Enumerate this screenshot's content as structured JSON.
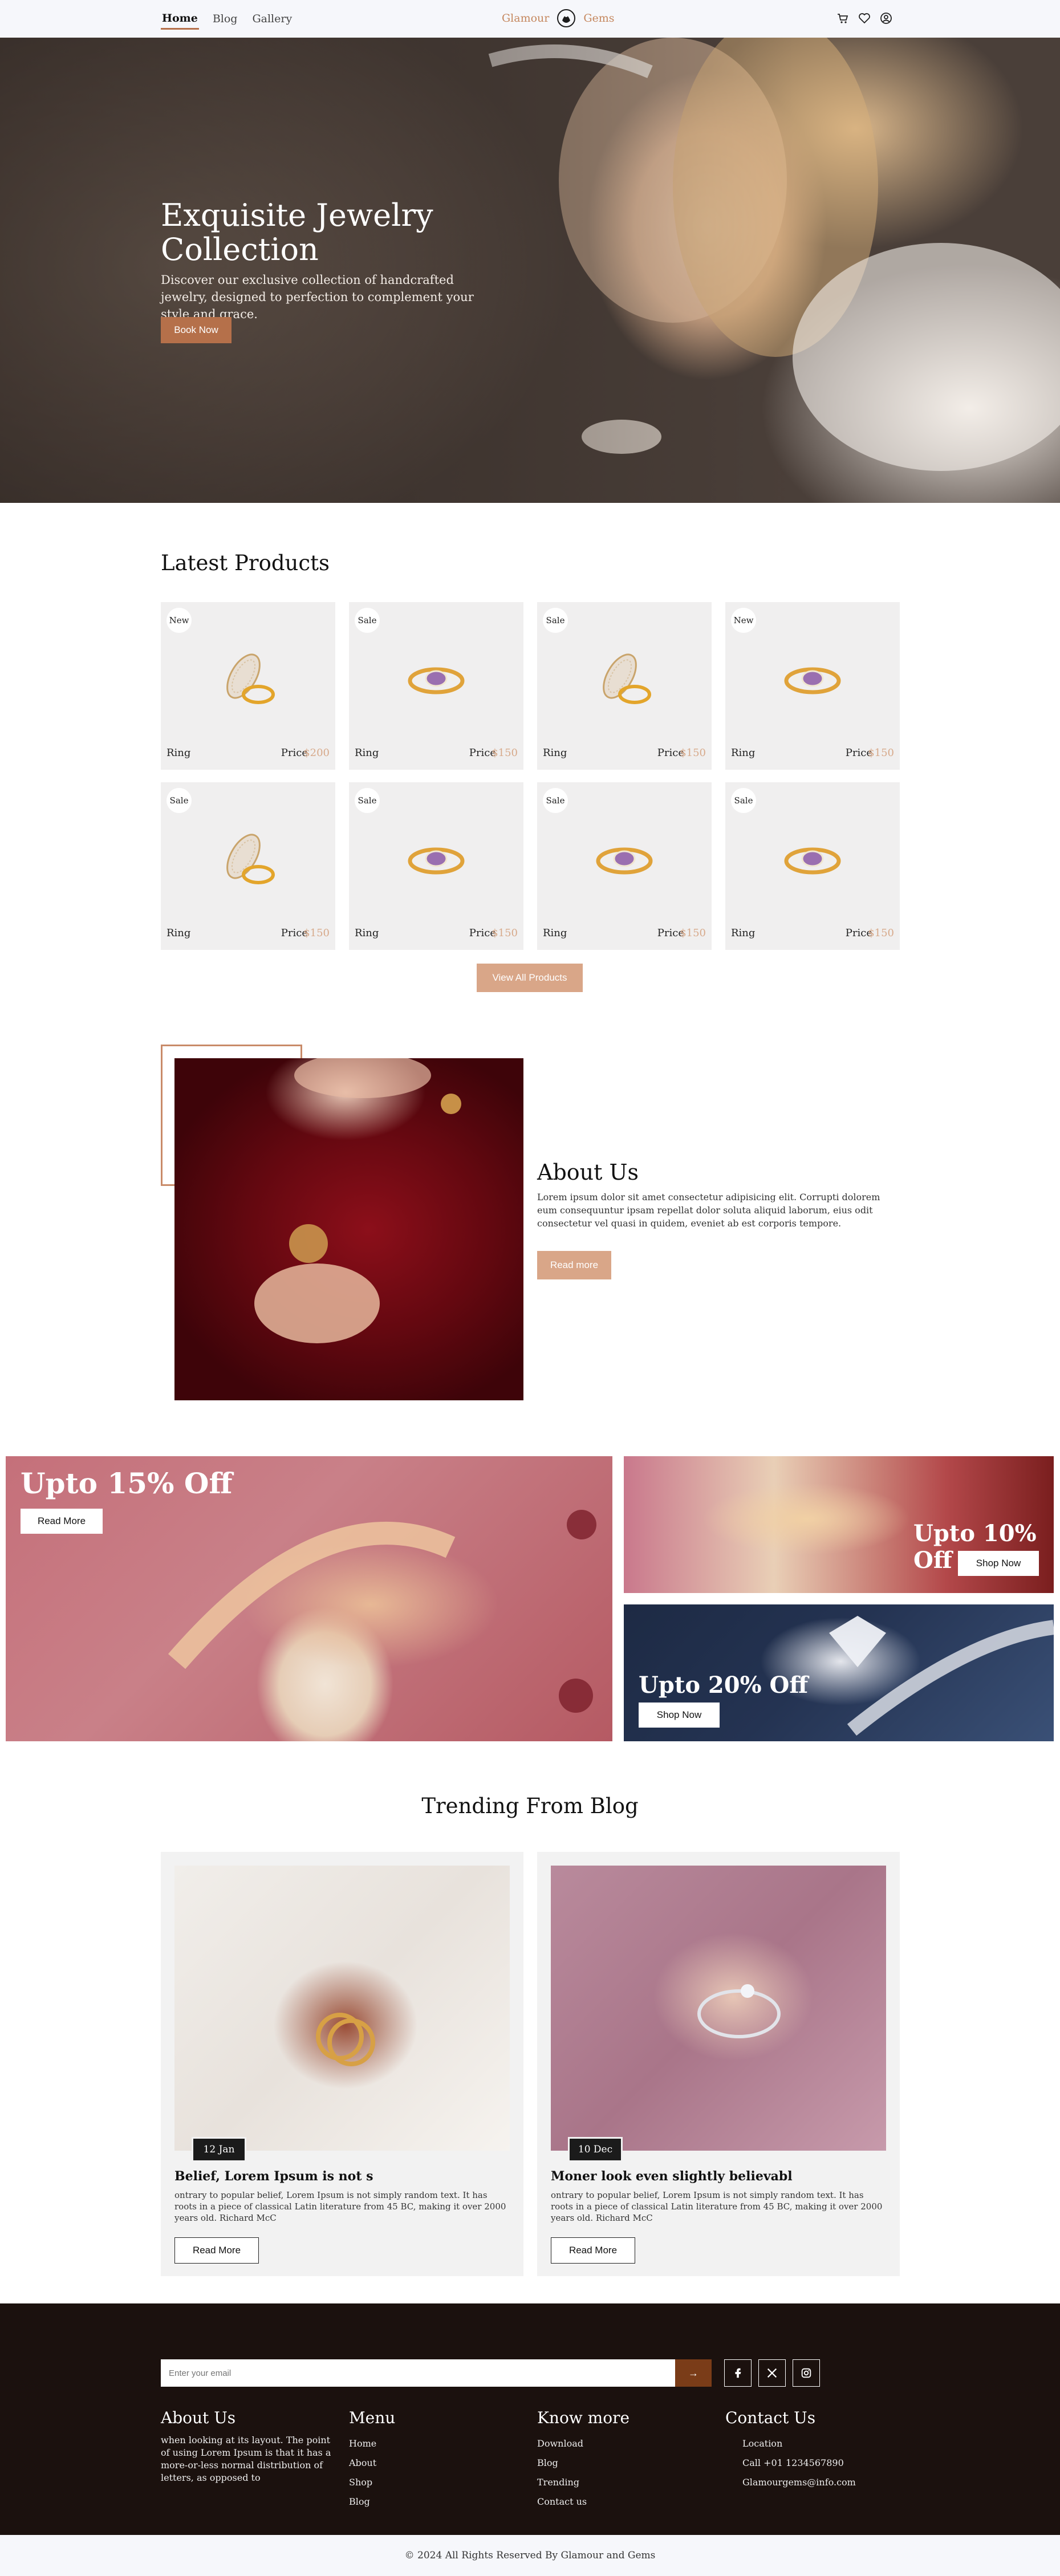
{
  "nav": {
    "links": [
      "Home",
      "Blog",
      "Gallery"
    ],
    "brand_left": "Glamour",
    "brand_right": "Gems",
    "icons": [
      "cart-icon",
      "heart-icon",
      "user-icon"
    ]
  },
  "hero": {
    "title": "Exquisite Jewelry Collection",
    "description": "Discover our exclusive collection of handcrafted jewelry, designed to perfection to complement your style and grace.",
    "button": "Book Now"
  },
  "latest": {
    "title": "Latest Products",
    "price_label": "Price",
    "products": [
      {
        "badge": "New",
        "name": "Ring",
        "price": "$200",
        "style": "diamond"
      },
      {
        "badge": "Sale",
        "name": "Ring",
        "price": "$150",
        "style": "amethyst"
      },
      {
        "badge": "Sale",
        "name": "Ring",
        "price": "$150",
        "style": "diamond"
      },
      {
        "badge": "New",
        "name": "Ring",
        "price": "$150",
        "style": "amethyst"
      },
      {
        "badge": "Sale",
        "name": "Ring",
        "price": "$150",
        "style": "diamond"
      },
      {
        "badge": "Sale",
        "name": "Ring",
        "price": "$150",
        "style": "amethyst"
      },
      {
        "badge": "Sale",
        "name": "Ring",
        "price": "$150",
        "style": "amethyst"
      },
      {
        "badge": "Sale",
        "name": "Ring",
        "price": "$150",
        "style": "amethyst"
      }
    ],
    "view_all": "View All Products"
  },
  "about": {
    "title": "About Us",
    "text": "Lorem ipsum dolor sit amet consectetur adipisicing elit. Corrupti dolorem eum consequuntur ipsam repellat dolor soluta aliquid laborum, eius odit consectetur vel quasi in quidem, eveniet ab est corporis tempore.",
    "button": "Read more"
  },
  "offers": {
    "big": {
      "title": "Upto 15% Off",
      "button": "Read More"
    },
    "top_right": {
      "title": "Upto 10% Off",
      "button": "Shop Now"
    },
    "bottom_right": {
      "title": "Upto 20% Off",
      "button": "Shop Now"
    }
  },
  "blog": {
    "title": "Trending From Blog",
    "posts": [
      {
        "date": "12 Jan",
        "title": "Belief, Lorem Ipsum is not s",
        "text": "ontrary to popular belief, Lorem Ipsum is not simply random text. It has roots in a piece of classical Latin literature from 45 BC, making it over 2000 years old. Richard McC",
        "button": "Read More"
      },
      {
        "date": "10 Dec",
        "title": "Moner look even slightly believabl",
        "text": "ontrary to popular belief, Lorem Ipsum is not simply random text. It has roots in a piece of classical Latin literature from 45 BC, making it over 2000 years old. Richard McC",
        "button": "Read More"
      }
    ]
  },
  "footer": {
    "email_placeholder": "Enter your email",
    "email_button": "→",
    "social": [
      "facebook-icon",
      "x-icon",
      "instagram-icon"
    ],
    "about": {
      "title": "About Us",
      "text": "when looking at its layout. The point of using Lorem Ipsum is that it has a more-or-less normal distribution of letters, as opposed to"
    },
    "menu": {
      "title": "Menu",
      "items": [
        "Home",
        "About",
        "Shop",
        "Blog"
      ]
    },
    "know": {
      "title": "Know more",
      "items": [
        "Download",
        "Blog",
        "Trending",
        "Contact us"
      ]
    },
    "contact": {
      "title": "Contact Us",
      "items": [
        "Location",
        "Call +01 1234567890",
        "Glamourgems@info.com"
      ]
    },
    "copyright": "© 2024 All Rights Reserved By Glamour and Gems"
  },
  "colors": {
    "accent": "#b5704a",
    "accent_light": "#d9a688",
    "price": "#d7a98a",
    "footer_bg": "#1b110e"
  }
}
